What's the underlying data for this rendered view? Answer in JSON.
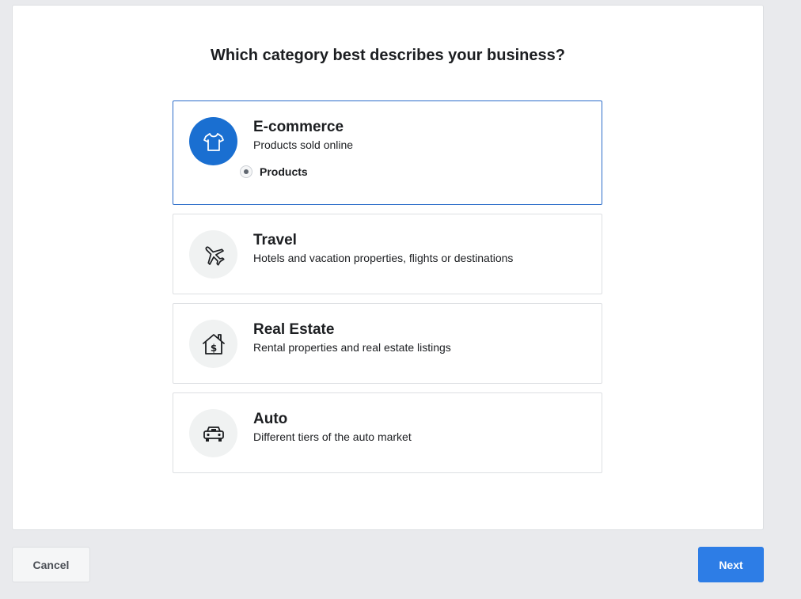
{
  "page": {
    "title": "Which category best describes your business?"
  },
  "options": [
    {
      "title": "E-commerce",
      "description": "Products sold online",
      "icon": "tshirt-icon",
      "selected": true,
      "sub_option": "Products"
    },
    {
      "title": "Travel",
      "description": "Hotels and vacation properties, flights or destinations",
      "icon": "airplane-icon",
      "selected": false
    },
    {
      "title": "Real Estate",
      "description": "Rental properties and real estate listings",
      "icon": "house-dollar-icon",
      "selected": false
    },
    {
      "title": "Auto",
      "description": "Different tiers of the auto market",
      "icon": "car-icon",
      "selected": false
    }
  ],
  "footer": {
    "cancel_label": "Cancel",
    "next_label": "Next"
  },
  "colors": {
    "accent": "#1a6fd1",
    "next_button": "#2d7de6",
    "background": "#e9eaed"
  }
}
